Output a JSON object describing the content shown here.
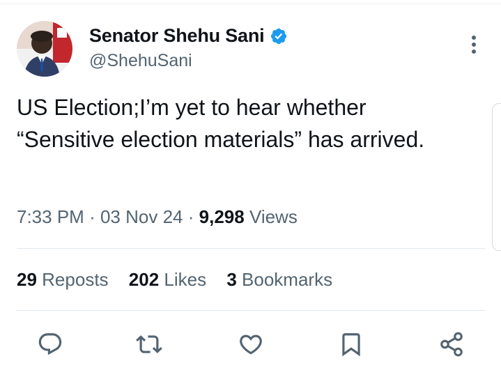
{
  "tweet": {
    "author_name": "Senator Shehu Sani",
    "handle": "@ShehuSani",
    "text": "US Election;I’m yet to hear whether “Sensitive election materials” has arrived.",
    "time": "7:33 PM",
    "date": "03 Nov 24",
    "views_count": "9,298",
    "views_label": "Views",
    "separator": "·"
  },
  "stats": {
    "reposts_count": "29",
    "reposts_label": "Reposts",
    "likes_count": "202",
    "likes_label": "Likes",
    "bookmarks_count": "3",
    "bookmarks_label": "Bookmarks"
  },
  "icons": {
    "verified": "verified-badge-icon",
    "more": "more-vertical-icon",
    "reply": "reply-icon",
    "repost": "repost-icon",
    "like": "like-icon",
    "bookmark": "bookmark-icon",
    "share": "share-icon"
  },
  "colors": {
    "verified_blue": "#1d9bf0",
    "secondary_text": "#536471",
    "primary_text": "#0f1419"
  }
}
